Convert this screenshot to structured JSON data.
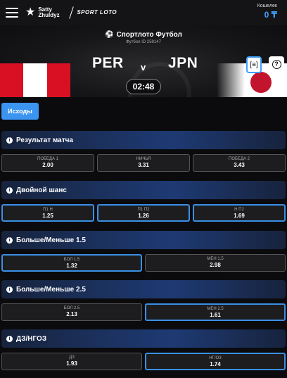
{
  "header": {
    "brand_primary": "Satty Zhuldyz",
    "brand_secondary": "SPORT LOTO",
    "wallet_label": "Кошелек",
    "wallet_amount": "0 ₸"
  },
  "match": {
    "competition": "Спортлото Футбол",
    "match_id": "Футбол ID 259147",
    "home_team": "PER",
    "away_team": "JPN",
    "vs": "v",
    "timer": "02:48"
  },
  "tabs": [
    {
      "label": "Исходы",
      "active": true
    }
  ],
  "markets": [
    {
      "title": "Результат матча",
      "odds": [
        {
          "label": "ПОБЕДА 1",
          "value": "2.00"
        },
        {
          "label": "НИЧЬЯ",
          "value": "3.31"
        },
        {
          "label": "ПОБЕДА 2",
          "value": "3.43"
        }
      ]
    },
    {
      "title": "Двойной шанс",
      "odds": [
        {
          "label": "П1 Н",
          "value": "1.25"
        },
        {
          "label": "П1 П2",
          "value": "1.26"
        },
        {
          "label": "Н П2",
          "value": "1.69"
        }
      ]
    },
    {
      "title": "Больше/Меньше 1.5",
      "odds": [
        {
          "label": "БОЛ 1.5",
          "value": "1.32"
        },
        {
          "label": "МЕН 1.5",
          "value": "2.98"
        }
      ]
    },
    {
      "title": "Больше/Меньше 2.5",
      "odds": [
        {
          "label": "БОЛ 2.5",
          "value": "2.13"
        },
        {
          "label": "МЕН 2.5",
          "value": "1.61"
        }
      ]
    },
    {
      "title": "ДЗ/НГОЗ",
      "odds": [
        {
          "label": "ДЗ",
          "value": "1.93"
        },
        {
          "label": "НГ/ОЗ",
          "value": "1.74"
        }
      ]
    }
  ],
  "colors": {
    "accent": "#3b94f0",
    "currency": "#3ea0ff",
    "peru_red": "#d91023",
    "japan_red": "#c2142c"
  },
  "icons": [
    "menu-icon",
    "logo-star-icon",
    "soccer-ball-icon",
    "stats-icon",
    "help-icon",
    "info-icon"
  ]
}
